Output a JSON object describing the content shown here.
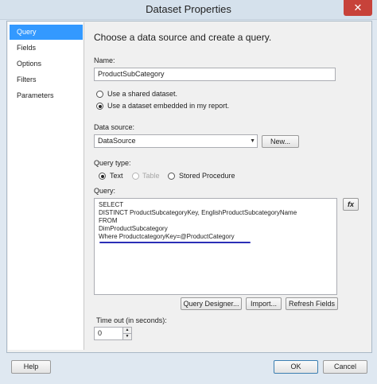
{
  "window": {
    "title": "Dataset Properties",
    "close_glyph": "✕"
  },
  "sidebar": {
    "items": [
      {
        "label": "Query",
        "selected": true
      },
      {
        "label": "Fields"
      },
      {
        "label": "Options"
      },
      {
        "label": "Filters"
      },
      {
        "label": "Parameters"
      }
    ]
  },
  "main": {
    "heading": "Choose a data source and create a query.",
    "name_label": "Name:",
    "name_value": "ProductSubCategory",
    "shared_radio_label": "Use a shared dataset.",
    "embedded_radio_label": "Use a dataset embedded in my report.",
    "datasource_label": "Data source:",
    "datasource_value": "DataSource",
    "new_button": "New...",
    "querytype_label": "Query type:",
    "querytype_text": "Text",
    "querytype_table": "Table",
    "querytype_sp": "Stored Procedure",
    "query_label": "Query:",
    "query_lines": [
      "SELECT",
      "DISTINCT ProductSubcategoryKey, EnglishProductSubcategoryName",
      "FROM",
      "DimProductSubcategory",
      "Where ProductcategoryKey=@ProductCategory"
    ],
    "fx_button": "fx",
    "query_designer_button": "Query Designer...",
    "import_button": "Import...",
    "refresh_fields_button": "Refresh Fields",
    "timeout_label": "Time out (in seconds):",
    "timeout_value": "0"
  },
  "footer": {
    "help_button": "Help",
    "ok_button": "OK",
    "cancel_button": "Cancel"
  },
  "colors": {
    "selection": "#3399ff",
    "underline": "#2b2fb6",
    "close": "#c7423a"
  }
}
